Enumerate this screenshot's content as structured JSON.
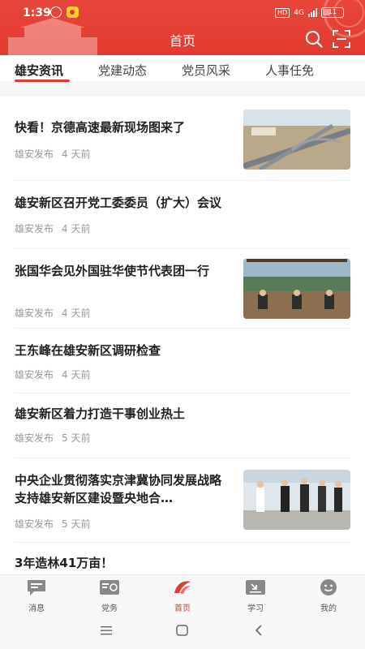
{
  "status_bar": {
    "time": "1:39",
    "network": "4G",
    "battery": "11"
  },
  "header": {
    "title": "首页"
  },
  "tabs": [
    {
      "label": "雄安资讯",
      "active": true
    },
    {
      "label": "党建动态"
    },
    {
      "label": "党员风采"
    },
    {
      "label": "人事任免"
    }
  ],
  "news": [
    {
      "title": "快看！京德高速最新现场图来了",
      "source": "雄安发布",
      "time": "4 天前",
      "image": "highway-aerial"
    },
    {
      "title": "雄安新区召开党工委委员（扩大）会议",
      "source": "雄安发布",
      "time": "4 天前"
    },
    {
      "title": "张国华会见外国驻华使节代表团一行",
      "source": "雄安发布",
      "time": "4 天前",
      "image": "meeting-room"
    },
    {
      "title": "王东峰在雄安新区调研检查",
      "source": "雄安发布",
      "time": "4 天前"
    },
    {
      "title": "雄安新区着力打造干事创业热土",
      "source": "雄安发布",
      "time": "5 天前"
    },
    {
      "title": "中央企业贯彻落实京津冀协同发展战略支持雄安新区建设暨央地合…",
      "source": "雄安发布",
      "time": "5 天前",
      "image": "officials-walking"
    },
    {
      "title": "3年造林41万亩！"
    }
  ],
  "bottom_nav": [
    {
      "label": "消息",
      "icon": "message-icon"
    },
    {
      "label": "党务",
      "icon": "party-affairs-icon"
    },
    {
      "label": "首页",
      "icon": "home-logo-icon",
      "active": true
    },
    {
      "label": "学习",
      "icon": "study-icon"
    },
    {
      "label": "我的",
      "icon": "profile-icon"
    }
  ],
  "colors": {
    "brand_red": "#e13a2f",
    "muted_text": "#999999"
  }
}
